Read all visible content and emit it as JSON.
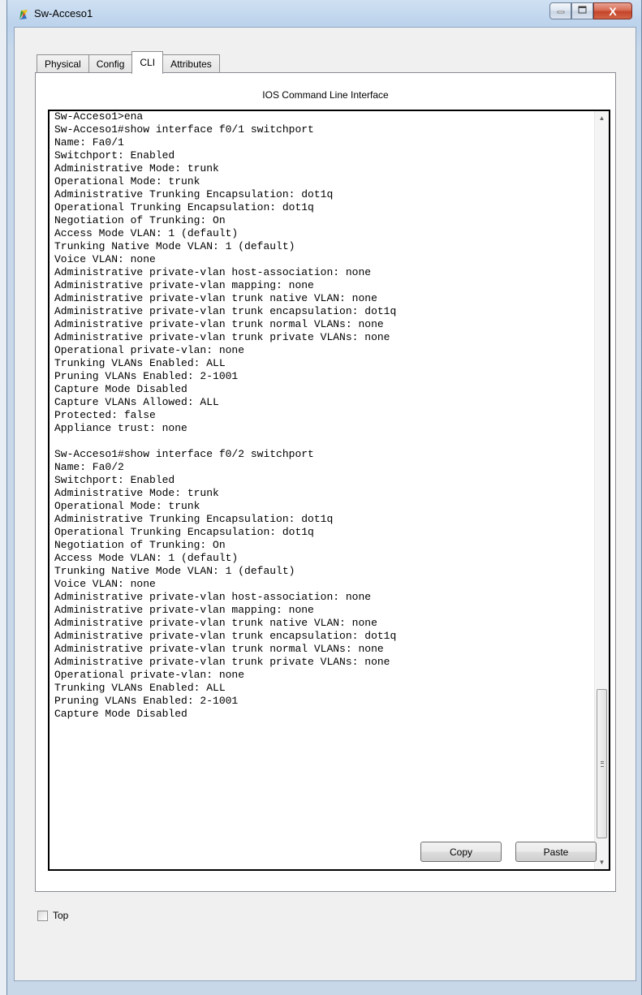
{
  "window": {
    "title": "Sw-Acceso1",
    "minimize_icon": "minimize-icon",
    "maximize_icon": "maximize-icon",
    "close_glyph": "X"
  },
  "tabs": [
    {
      "label": "Physical",
      "active": false
    },
    {
      "label": "Config",
      "active": false
    },
    {
      "label": "CLI",
      "active": true
    },
    {
      "label": "Attributes",
      "active": false
    }
  ],
  "cli": {
    "heading": "IOS Command Line Interface",
    "output": "Sw-Acceso1>ena\nSw-Acceso1#show interface f0/1 switchport\nName: Fa0/1\nSwitchport: Enabled\nAdministrative Mode: trunk\nOperational Mode: trunk\nAdministrative Trunking Encapsulation: dot1q\nOperational Trunking Encapsulation: dot1q\nNegotiation of Trunking: On\nAccess Mode VLAN: 1 (default)\nTrunking Native Mode VLAN: 1 (default)\nVoice VLAN: none\nAdministrative private-vlan host-association: none\nAdministrative private-vlan mapping: none\nAdministrative private-vlan trunk native VLAN: none\nAdministrative private-vlan trunk encapsulation: dot1q\nAdministrative private-vlan trunk normal VLANs: none\nAdministrative private-vlan trunk private VLANs: none\nOperational private-vlan: none\nTrunking VLANs Enabled: ALL\nPruning VLANs Enabled: 2-1001\nCapture Mode Disabled\nCapture VLANs Allowed: ALL\nProtected: false\nAppliance trust: none\n\nSw-Acceso1#show interface f0/2 switchport\nName: Fa0/2\nSwitchport: Enabled\nAdministrative Mode: trunk\nOperational Mode: trunk\nAdministrative Trunking Encapsulation: dot1q\nOperational Trunking Encapsulation: dot1q\nNegotiation of Trunking: On\nAccess Mode VLAN: 1 (default)\nTrunking Native Mode VLAN: 1 (default)\nVoice VLAN: none\nAdministrative private-vlan host-association: none\nAdministrative private-vlan mapping: none\nAdministrative private-vlan trunk native VLAN: none\nAdministrative private-vlan trunk encapsulation: dot1q\nAdministrative private-vlan trunk normal VLANs: none\nAdministrative private-vlan trunk private VLANs: none\nOperational private-vlan: none\nTrunking VLANs Enabled: ALL\nPruning VLANs Enabled: 2-1001\nCapture Mode Disabled"
  },
  "buttons": {
    "copy": "Copy",
    "paste": "Paste"
  },
  "footer": {
    "top_checkbox_label": "Top",
    "top_checked": false
  },
  "colors": {
    "close_button": "#c4442a",
    "window_frame": "#bcd3ec"
  }
}
